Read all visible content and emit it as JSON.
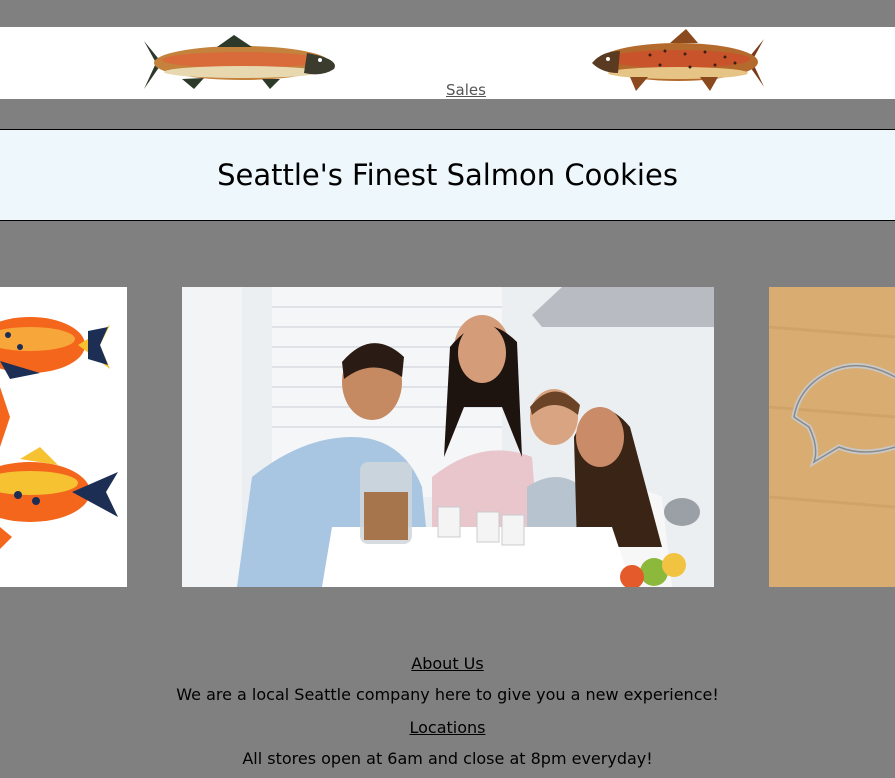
{
  "header": {
    "nav_sales": "Sales"
  },
  "hero": {
    "title": "Seattle's Finest Salmon Cookies"
  },
  "gallery": {
    "images": [
      {
        "name": "fish-cookies-image"
      },
      {
        "name": "family-kitchen-photo"
      },
      {
        "name": "fish-cookie-cutter-image"
      }
    ]
  },
  "info": {
    "about_link": "About Us",
    "about_text": "We are a local Seattle company here to give you a new experience!",
    "locations_link": "Locations",
    "locations_text": "All stores open at 6am and close at 8pm everyday!"
  },
  "colors": {
    "page_bg": "#808080",
    "title_band_bg": "#eef8fc",
    "link_gray": "#555555"
  }
}
